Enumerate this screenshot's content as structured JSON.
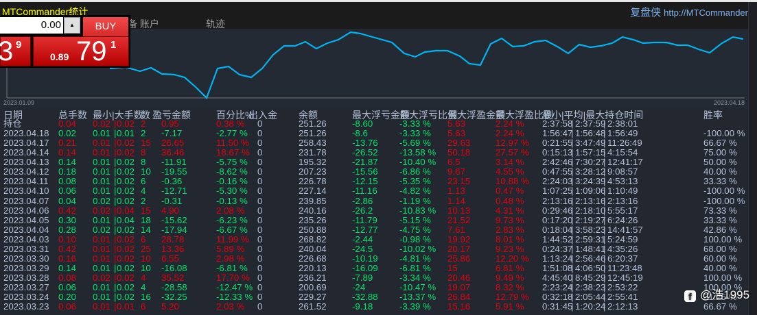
{
  "header": {
    "title": "MTCommander统计",
    "brand_cn": "复盘侠",
    "brand_url": "http://MTCommander"
  },
  "tabs": [
    "备 账户",
    "轨迹"
  ],
  "trade_panel": {
    "qty": "0.00",
    "buy_label": "BUY",
    "sell_big": "3",
    "sell_sup": "9",
    "buy_small": "0.89",
    "buy_big": "79",
    "buy_sup": "1"
  },
  "chart": {
    "x_start": "2023.01.09",
    "x_end": "2023.04.18",
    "line_color": "#00b4f0"
  },
  "table": {
    "headers": [
      "日期",
      "总手数",
      "最小|大手数",
      "数",
      "盈亏金额",
      "百分比%",
      "出入金",
      "余额",
      "最大浮亏金额",
      "最大浮亏比例",
      "最大浮盈金额",
      "最大浮盈比例",
      "最小|平均|最大持仓时间",
      "胜率"
    ],
    "rows": [
      [
        "持仓",
        "0.04",
        "0.02",
        "0.02",
        "2",
        "0.95",
        "0.38 %",
        "0",
        "251.26",
        "-8.60",
        "-3.33 %",
        "5.63",
        "2.24 %",
        "2:37:58",
        "2:37:59",
        "2:38:01",
        ""
      ],
      [
        "2023.04.18",
        "0.02",
        "0.01",
        "0.01",
        "2",
        "-7.17",
        "-2.77 %",
        "0",
        "251.26",
        "-8.6",
        "-3.33 %",
        "5.63",
        "2.24 %",
        "1:56:47",
        "1:56:48",
        "1:56:49",
        "-100.00 %"
      ],
      [
        "2023.04.17",
        "0.21",
        "0.01",
        "0.02",
        "15",
        "26.65",
        "11.50 %",
        "0",
        "258.43",
        "-13.76",
        "-5.69 %",
        "29.63",
        "12.97 %",
        "0:21:55",
        "3:47:49",
        "11:26:49",
        "66.67 %"
      ],
      [
        "2023.04.14",
        "0.14",
        "0.01",
        "0.02",
        "8",
        "36.46",
        "18.67 %",
        "0",
        "231.78",
        "-26.52",
        "-13.58 %",
        "50.18",
        "27.57 %",
        "0:15:13",
        "1:57:15",
        "4:15:54",
        "75.00 %"
      ],
      [
        "2023.04.13",
        "0.14",
        "0.01",
        "0.02",
        "8",
        "-11.91",
        "-5.75 %",
        "0",
        "195.32",
        "-21.87",
        "-10.40 %",
        "6.5",
        "3.14 %",
        "2:42:46",
        "7:30:27",
        "12:41:17",
        "50.00 %"
      ],
      [
        "2023.04.12",
        "0.18",
        "0.01",
        "0.02",
        "10",
        "-19.55",
        "-8.62 %",
        "0",
        "207.23",
        "-15.56",
        "-6.86 %",
        "9.67",
        "4.55 %",
        "0:47:55",
        "3:28:12",
        "9:08:57",
        "40.00 %"
      ],
      [
        "2023.04.11",
        "0.08",
        "0.01",
        "0.02",
        "6",
        "-0.36",
        "-0.16 %",
        "0",
        "226.78",
        "-12.15",
        "-5.35 %",
        "23.15",
        "10.88 %",
        "2:24:03",
        "3:24:39",
        "4:53:13",
        "33.33 %"
      ],
      [
        "2023.04.10",
        "0.06",
        "0.01",
        "0.02",
        "4",
        "-12.71",
        "-5.30 %",
        "0",
        "227.14",
        "-11.16",
        "-4.82 %",
        "1.13",
        "0.47 %",
        "1:07:25",
        "1:09:06",
        "1:10:49",
        "-100.00 %"
      ],
      [
        "2023.04.07",
        "0.04",
        "0.02",
        "0.02",
        "2",
        "-0.31",
        "-0.13 %",
        "0",
        "239.85",
        "-2.86",
        "-1.19 %",
        "1.14",
        "0.48 %",
        "2:13:16",
        "2:13:16",
        "2:13:16",
        "-100.00 %"
      ],
      [
        "2023.04.06",
        "0.42",
        "0.02",
        "0.04",
        "15",
        "4.90",
        "2.08 %",
        "0",
        "240.16",
        "-26.2",
        "-10.83 %",
        "10.13",
        "4.31 %",
        "0:29:46",
        "2:18:10",
        "5:55:17",
        "73.33 %"
      ],
      [
        "2023.04.05",
        "0.30",
        "0.01",
        "0.04",
        "18",
        "-15.62",
        "-6.23 %",
        "0",
        "235.26",
        "-11.79",
        "-5.15 %",
        "21.52",
        "9.73 %",
        "0:17:20",
        "2:19:27",
        "6:24:26",
        "33.33 %"
      ],
      [
        "2023.04.04",
        "0.28",
        "0.02",
        "0.02",
        "14",
        "-17.94",
        "-6.67 %",
        "0",
        "250.88",
        "-12.77",
        "-4.75 %",
        "7.61",
        "2.83 %",
        "0:18:04",
        "3:58:23",
        "14:41:57",
        "42.86 %"
      ],
      [
        "2023.04.03",
        "0.10",
        "0.01",
        "0.02",
        "6",
        "28.78",
        "11.99 %",
        "0",
        "268.82",
        "-2.44",
        "-0.98 %",
        "19.92",
        "8.01 %",
        "1:44:52",
        "2:59:31",
        "5:24:59",
        "100.00 %"
      ],
      [
        "2023.03.31",
        "0.42",
        "0.01",
        "0.02",
        "25",
        "13.36",
        "5.89 %",
        "0",
        "240.04",
        "-24.5",
        "-10.02 %",
        "20.17",
        "9.23 %",
        "0:24:37",
        "1:48:41",
        "4:35:26",
        "68.00 %"
      ],
      [
        "2023.03.30",
        "0.16",
        "0.01",
        "0.02",
        "10",
        "6.55",
        "2.98 %",
        "0",
        "226.68",
        "-10.19",
        "-4.81 %",
        "25.86",
        "12.20 %",
        "1:13:24",
        "2:56:46",
        "6:20:37",
        "60.00 %"
      ],
      [
        "2023.03.29",
        "0.14",
        "0.01",
        "0.02",
        "10",
        "-16.08",
        "-6.81 %",
        "0",
        "220.13",
        "-16.09",
        "-6.81 %",
        "15",
        "6.81 %",
        "1:51:08",
        "4:06:50",
        "11:23:48",
        "40.00 %"
      ],
      [
        "2023.03.28",
        "0.08",
        "0.02",
        "0.02",
        "4",
        "35.52",
        "17.70 %",
        "0",
        "236.21",
        "-7.89",
        "-3.34 %",
        "20.46",
        "9.49 %",
        "4:45:40",
        "8:45:29",
        "12:45:19",
        "100.00 %"
      ],
      [
        "2023.03.27",
        "0.06",
        "0.01",
        "0.02",
        "4",
        "-28.58",
        "-12.47 %",
        "0",
        "200.69",
        "-24",
        "-10.47 %",
        "19.07",
        "8.32 %",
        "2:23:24",
        "2:38:23",
        "2:53:22",
        "100.00 %"
      ],
      [
        "2023.03.24",
        "0.20",
        "0.01",
        "0.02",
        "16",
        "-32.25",
        "-12.33 %",
        "0",
        "229.27",
        "-32.88",
        "-13.37 %",
        "26.84",
        "12.79 %",
        "0:32:18",
        "2:05:44",
        "2:55:41",
        "31.25 %"
      ],
      [
        "2023.03.23",
        "0.06",
        "0.01",
        "0.01",
        "6",
        "5.20",
        "2.03 %",
        "0",
        "261.52",
        "-9.18",
        "-3.39 %",
        "15.16",
        "5.91 %",
        "0:31:45",
        "1:20:24",
        "2:12:13",
        "66.67 %"
      ]
    ]
  },
  "watermark": {
    "icon": "facebook-icon",
    "text": "@浩1995"
  },
  "colors": {
    "profit": "#e4000f",
    "loss": "#00e66c",
    "text": "#b4c0d6",
    "title": "#ffff00"
  }
}
